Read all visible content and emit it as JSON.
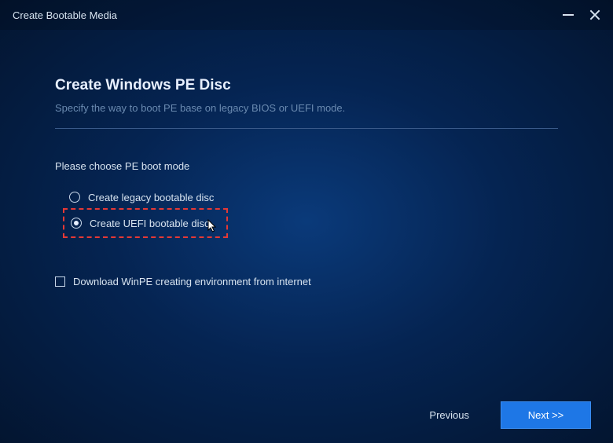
{
  "titlebar": {
    "title": "Create Bootable Media"
  },
  "page": {
    "title": "Create Windows PE Disc",
    "subtitle": "Specify the way to boot PE base on legacy BIOS or UEFI mode."
  },
  "section": {
    "label": "Please choose PE boot mode"
  },
  "options": {
    "legacy": {
      "label": "Create legacy bootable disc",
      "selected": false
    },
    "uefi": {
      "label": "Create UEFI bootable disc",
      "selected": true
    }
  },
  "checkbox": {
    "download": {
      "label": "Download WinPE creating environment from internet",
      "checked": false
    }
  },
  "footer": {
    "previous": "Previous",
    "next": "Next >>"
  },
  "colors": {
    "accent": "#1e77e6",
    "highlight": "#e53935"
  }
}
